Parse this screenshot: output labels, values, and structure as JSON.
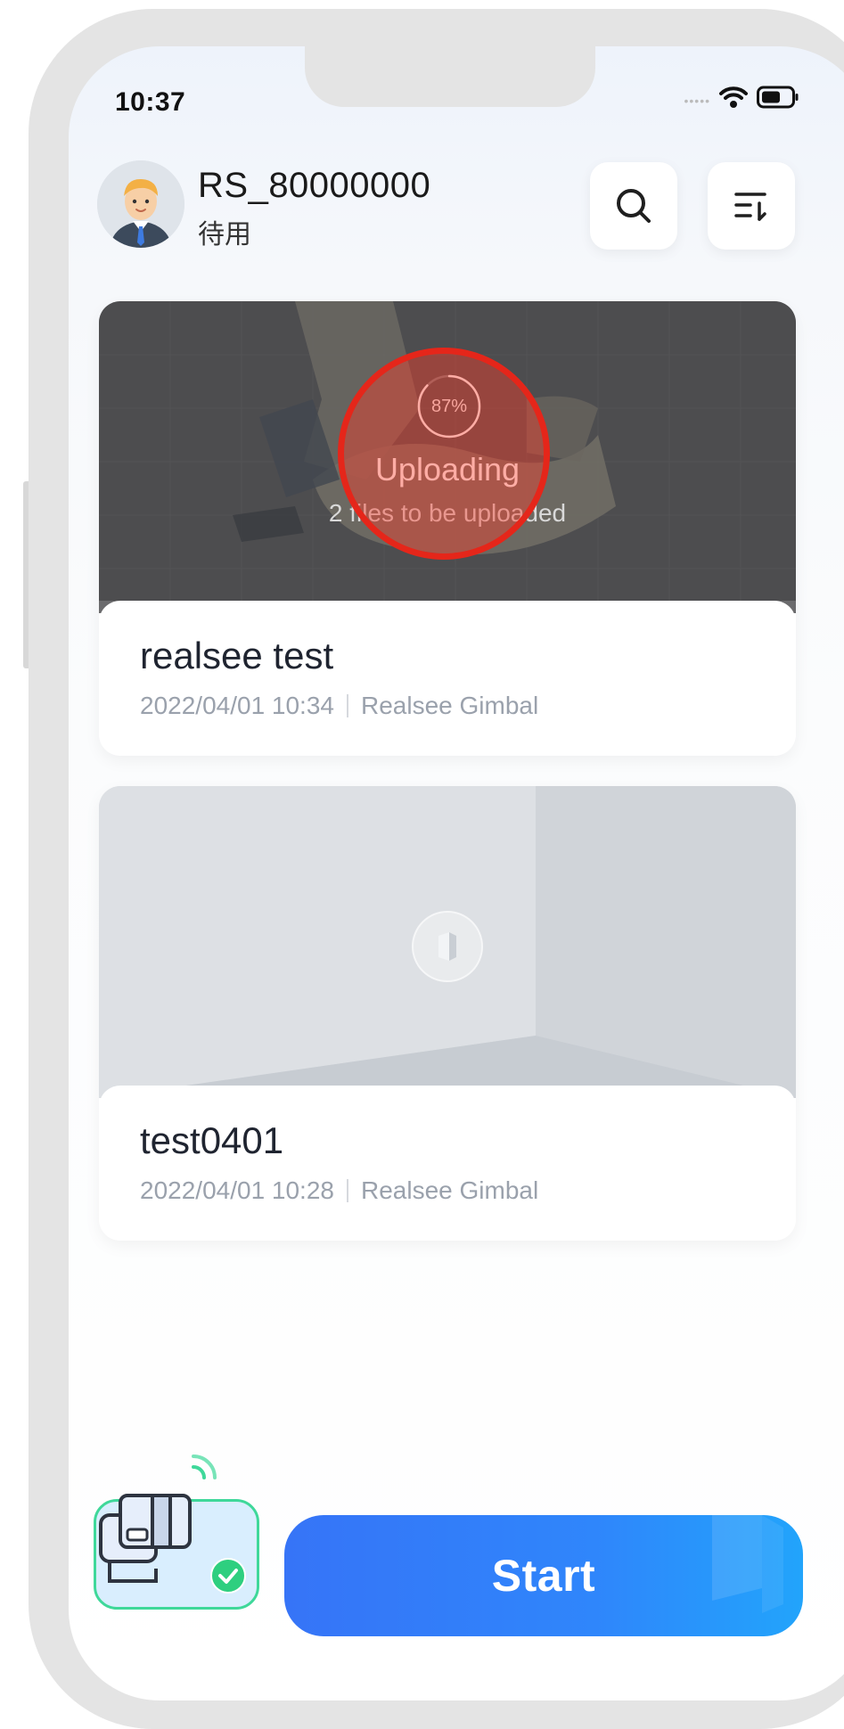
{
  "status_bar": {
    "time": "10:37"
  },
  "user": {
    "name": "RS_80000000",
    "status": "待用"
  },
  "projects": [
    {
      "title": "realsee test",
      "date": "2022/04/01 10:34",
      "device": "Realsee Gimbal",
      "upload": {
        "progress_percent": 87,
        "progress_label": "87%",
        "title": "Uploading",
        "subtitle": "2 files to be uploaded"
      }
    },
    {
      "title": "test0401",
      "date": "2022/04/01 10:28",
      "device": "Realsee Gimbal"
    }
  ],
  "start_button": {
    "label": "Start"
  },
  "colors": {
    "accent": "#2f86fb",
    "device_ok": "#3fd89a",
    "highlight": "#e5261a"
  }
}
